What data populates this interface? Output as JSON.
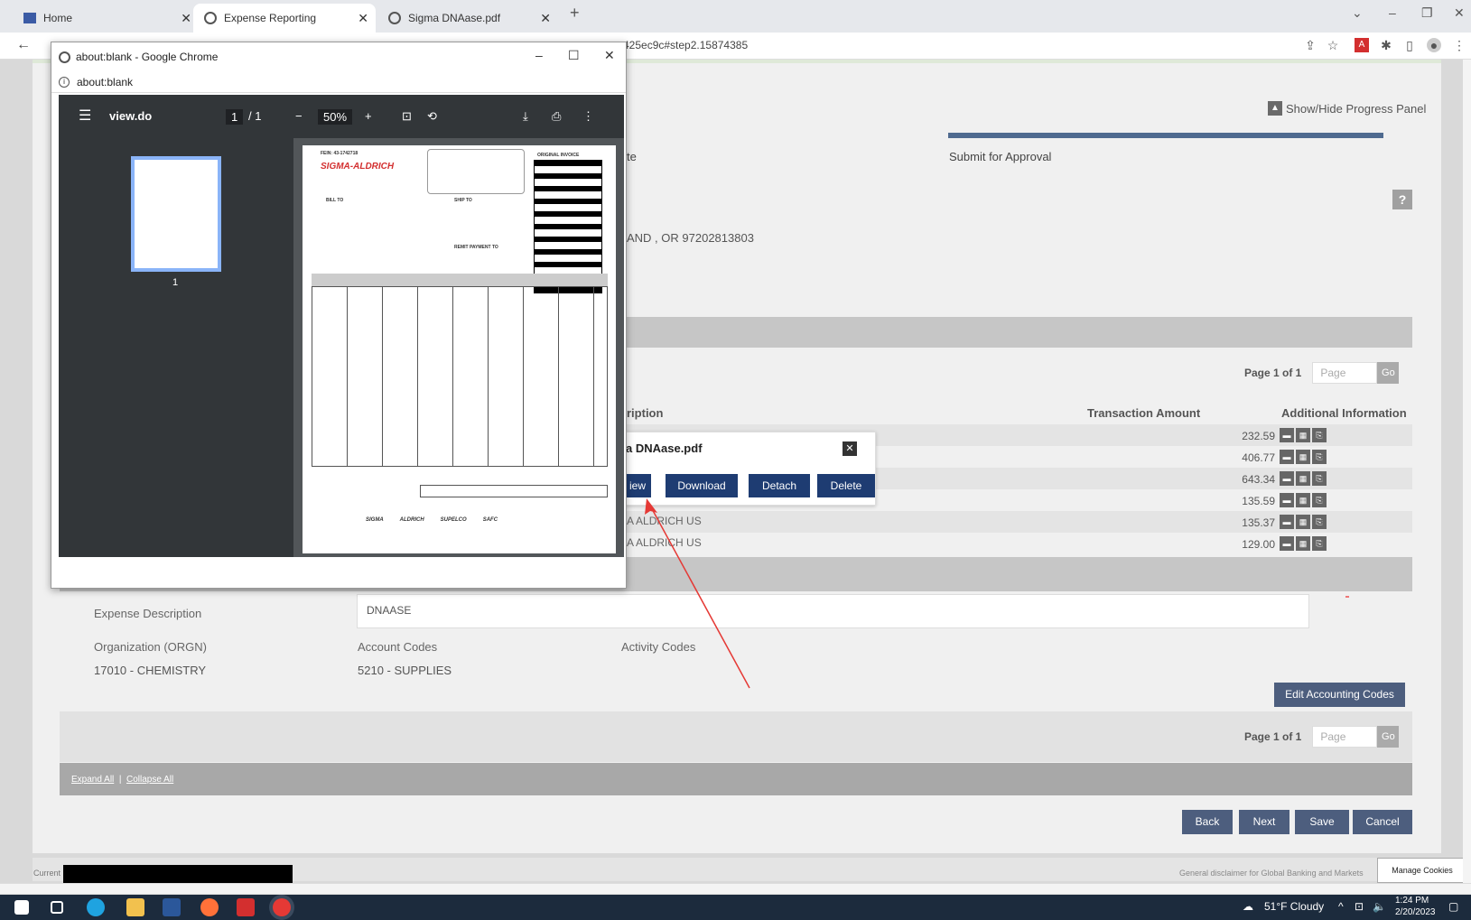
{
  "browser": {
    "tabs": [
      {
        "label": "Home"
      },
      {
        "label": "Expense Reporting"
      },
      {
        "label": "Sigma DNAase.pdf"
      }
    ],
    "url": "425ec9c#step2.15874385"
  },
  "page": {
    "show_hide_progress": "Show/Hide Progress Panel",
    "step_partial": "te",
    "step_submit": "Submit for Approval",
    "help": "?",
    "address_partial": "AND , OR 97202813803",
    "pager_top": {
      "label": "Page 1 of 1",
      "placeholder": "Page",
      "go": "Go"
    },
    "columns": {
      "description_partial": "ription",
      "transaction_amount": "Transaction Amount",
      "additional_info": "Additional Information"
    },
    "rows": [
      {
        "vendor": "",
        "amount": "232.59"
      },
      {
        "vendor": "",
        "amount": "406.77"
      },
      {
        "vendor": "",
        "amount": "643.34"
      },
      {
        "vendor": "",
        "amount": "135.59"
      },
      {
        "vendor": "A ALDRICH US",
        "amount": "135.37"
      },
      {
        "vendor": "A ALDRICH US",
        "amount": "129.00"
      }
    ],
    "expense_description_label": "Expense Description",
    "expense_description_value": "DNAASE",
    "orgn_label": "Organization (ORGN)",
    "orgn_value": "17010 - CHEMISTRY",
    "account_codes_label": "Account Codes",
    "account_codes_value": "5210 - SUPPLIES",
    "activity_codes_label": "Activity Codes",
    "edit_accounting_codes": "Edit Accounting Codes",
    "pager_bottom": {
      "label": "Page 1 of 1",
      "placeholder": "Page",
      "go": "Go"
    },
    "expand_all": "Expand All",
    "collapse_all": "Collapse All",
    "separator": "|",
    "buttons": {
      "back": "Back",
      "next": "Next",
      "save": "Save",
      "cancel": "Cancel"
    },
    "footer_left": "Current",
    "footer_right": "General disclaimer for Global Banking and Markets",
    "manage_cookies": "Manage Cookies"
  },
  "attachment": {
    "filename_partial": "a DNAase.pdf",
    "view_partial": "iew",
    "download": "Download",
    "detach": "Detach",
    "delete": "Delete"
  },
  "popup": {
    "title": "about:blank - Google Chrome",
    "url": "about:blank",
    "viewer": {
      "doc_name": "view.do",
      "page_current": "1",
      "page_sep": "/ 1",
      "zoom": "50%",
      "thumb_label": "1"
    },
    "invoice": {
      "fein": "FEIN: 43-1742718",
      "brand": "SIGMA-ALDRICH",
      "bill_to": "BILL TO",
      "ship_to": "SHIP TO",
      "original_invoice": "ORIGINAL INVOICE",
      "remit_payment_to": "REMIT PAYMENT TO",
      "footer_brands": [
        "SIGMA",
        "ALDRICH",
        "SUPELCO",
        "SAFC"
      ]
    }
  },
  "taskbar": {
    "weather": "51°F  Cloudy",
    "time": "1:24 PM",
    "date": "2/20/2023"
  },
  "colors": {
    "accent": "#4d5e7e",
    "attach_btn": "#1e3c72",
    "taskbar": "#1c2b3d"
  }
}
